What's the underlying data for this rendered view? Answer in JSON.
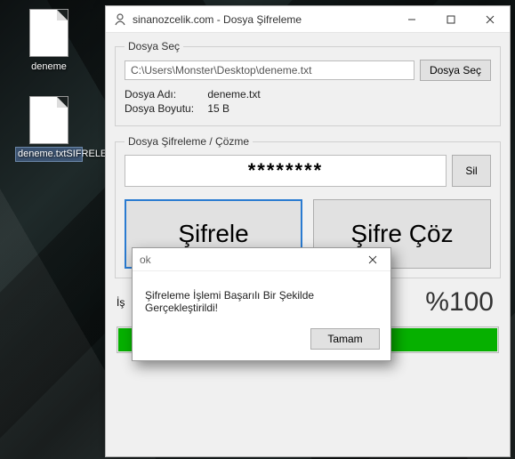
{
  "desktop": {
    "icons": [
      {
        "label": "deneme"
      },
      {
        "label": "deneme.txtSIFRELENDI"
      }
    ]
  },
  "window": {
    "title": "sinanozcelik.com - Dosya Şifreleme",
    "file_group": {
      "legend": "Dosya Seç",
      "path_value": "C:\\Users\\Monster\\Desktop\\deneme.txt",
      "browse_label": "Dosya Seç",
      "name_label": "Dosya Adı:",
      "name_value": "deneme.txt",
      "size_label": "Dosya Boyutu:",
      "size_value": "15 B"
    },
    "crypt_group": {
      "legend": "Dosya Şifreleme / Çözme",
      "password_value": "********",
      "clear_label": "Sil",
      "encrypt_label": "Şifrele",
      "decrypt_label": "Şifre Çöz"
    },
    "status": {
      "label_prefix": "İş",
      "percent_text": "%100"
    }
  },
  "dialog": {
    "title": "ok",
    "message": "Şifreleme İşlemi Başarılı Bir Şekilde Gerçekleştirildi!",
    "ok_label": "Tamam"
  },
  "colors": {
    "progress_fill": "#06b000",
    "focus_ring": "#2a7bd1"
  }
}
